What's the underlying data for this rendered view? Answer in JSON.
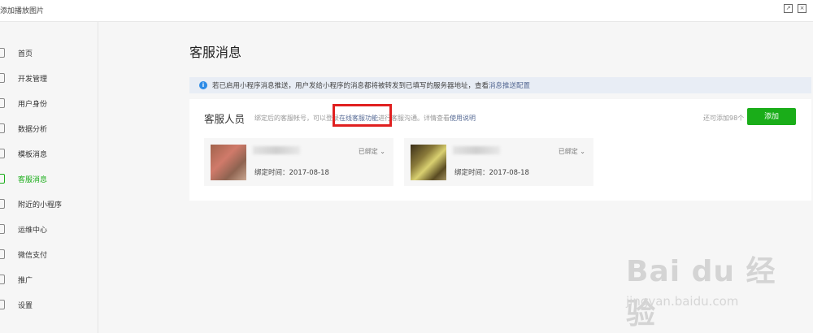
{
  "window": {
    "title": "添加播放图片",
    "external_icon": "external-link-icon",
    "close_icon": "close-icon"
  },
  "sidebar": {
    "items": [
      {
        "label": "首页",
        "icon": "home-icon"
      },
      {
        "label": "开发管理",
        "icon": "dev-icon"
      },
      {
        "label": "用户身份",
        "icon": "user-icon"
      },
      {
        "label": "数据分析",
        "icon": "chart-icon"
      },
      {
        "label": "模板消息",
        "icon": "template-icon"
      },
      {
        "label": "客服消息",
        "icon": "service-icon",
        "active": true
      },
      {
        "label": "附近的小程序",
        "icon": "location-icon"
      },
      {
        "label": "运维中心",
        "icon": "ops-icon"
      },
      {
        "label": "微信支付",
        "icon": "pay-icon"
      },
      {
        "label": "推广",
        "icon": "promo-icon"
      },
      {
        "label": "设置",
        "icon": "settings-icon"
      }
    ]
  },
  "page": {
    "title": "客服消息"
  },
  "notice": {
    "icon": "info-icon",
    "text": "若已启用小程序消息推送，用户发给小程序的消息都将被转发到已填写的服务器地址，查看",
    "link": "消息推送配置"
  },
  "staff": {
    "label": "客服人员",
    "desc_prefix": "绑定后的客服帐号，可以登录",
    "desc_link": "在线客服功能",
    "desc_middle": "进行客服沟通。详情查看",
    "desc_link2": "使用说明",
    "remaining": "还可添加98个",
    "add_label": "添加",
    "agents": [
      {
        "status": "已绑定",
        "time": "绑定时间：2017-08-18"
      },
      {
        "status": "已绑定",
        "time": "绑定时间：2017-08-18"
      }
    ]
  },
  "watermark": {
    "logo": "Bai du 经验",
    "url": "jingyan.baidu.com"
  },
  "colors": {
    "accent": "#1aad19",
    "link": "#576b95",
    "highlight": "#e02020",
    "info": "#2d8be6"
  }
}
